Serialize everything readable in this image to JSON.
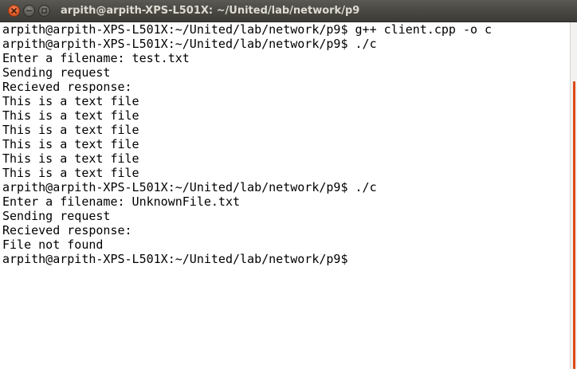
{
  "window": {
    "title": "arpith@arpith-XPS-L501X: ~/United/lab/network/p9"
  },
  "titlebar_buttons": {
    "close_icon": "close-icon",
    "minimize_icon": "minimize-icon",
    "maximize_icon": "maximize-icon"
  },
  "colors": {
    "close_button": "#e25a27",
    "scrollbar_thumb": "#dd4814",
    "terminal_bg": "#ffffff",
    "text": "#000000"
  },
  "terminal": {
    "lines": [
      "arpith@arpith-XPS-L501X:~/United/lab/network/p9$ g++ client.cpp -o c",
      "arpith@arpith-XPS-L501X:~/United/lab/network/p9$ ./c",
      "Enter a filename: test.txt",
      "Sending request",
      "Recieved response:",
      "This is a text file",
      "This is a text file",
      "This is a text file",
      "This is a text file",
      "This is a text file",
      "This is a text file",
      "arpith@arpith-XPS-L501X:~/United/lab/network/p9$ ./c",
      "Enter a filename: UnknownFile.txt",
      "Sending request",
      "Recieved response:",
      "File not found",
      "arpith@arpith-XPS-L501X:~/United/lab/network/p9$"
    ]
  }
}
